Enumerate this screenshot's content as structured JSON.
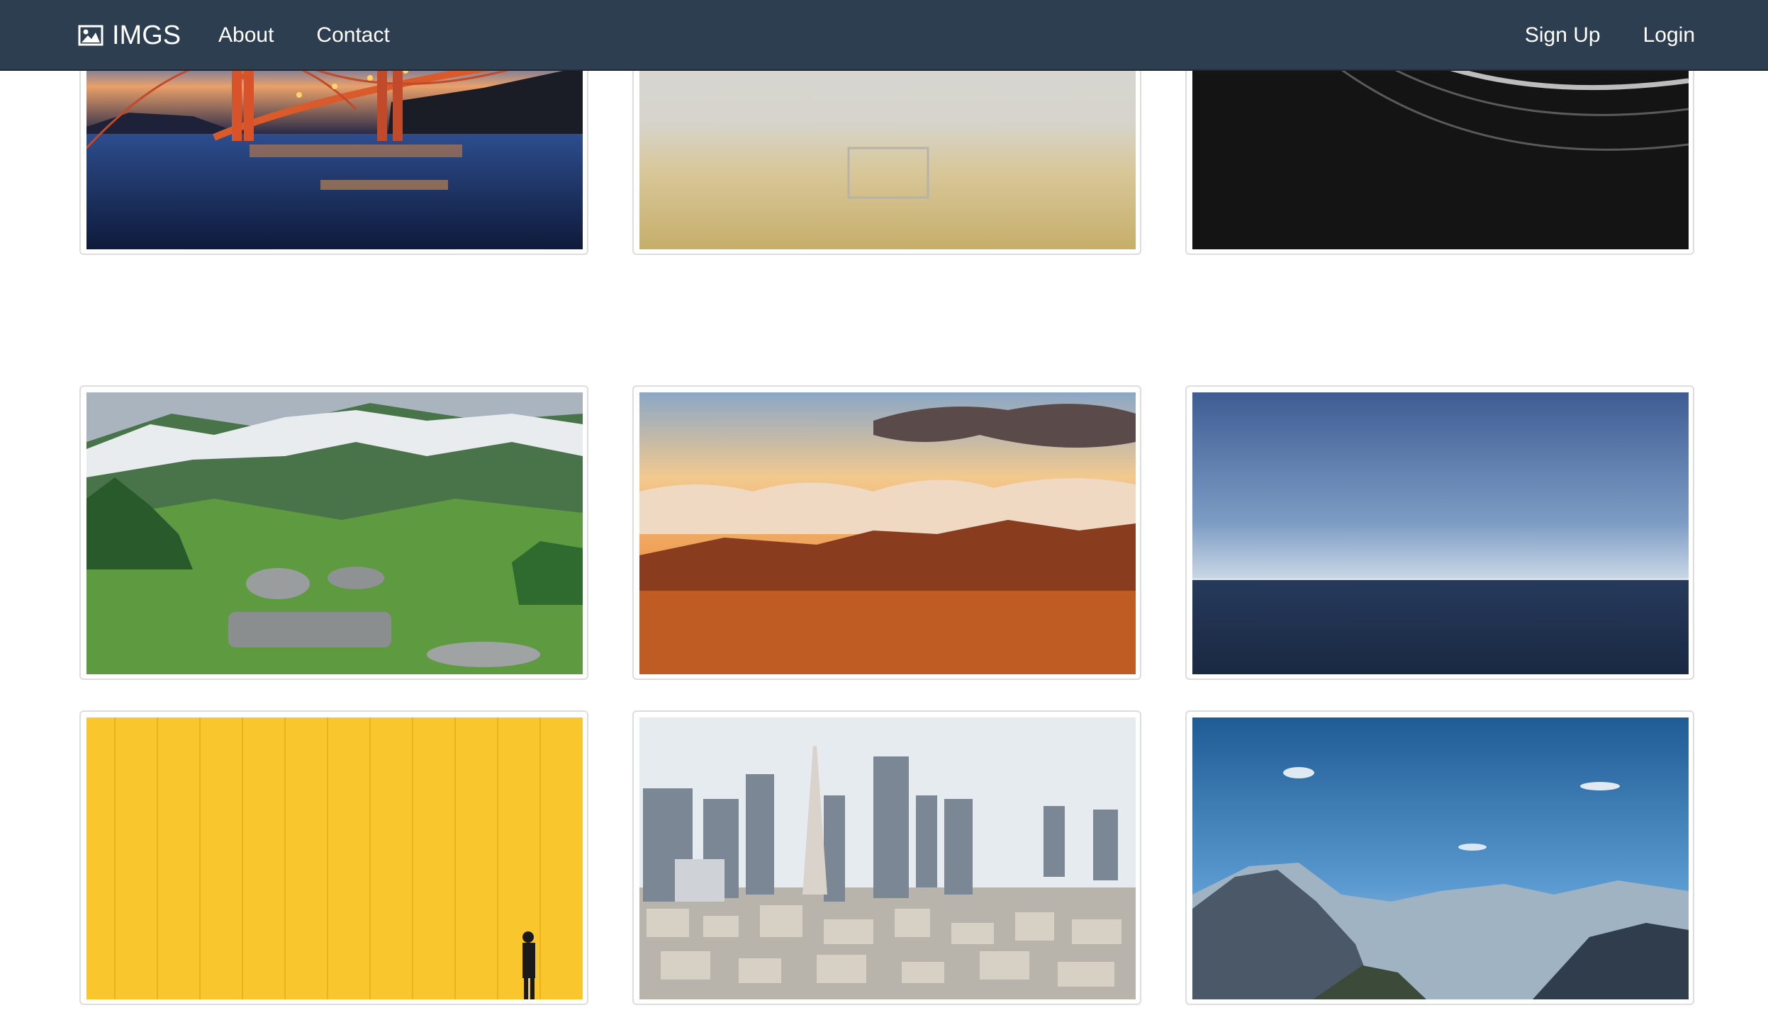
{
  "navbar": {
    "brand": "IMGS",
    "brand_icon": "image-icon",
    "links_left": [
      {
        "label": "About"
      },
      {
        "label": "Contact"
      }
    ],
    "links_right": [
      {
        "label": "Sign Up"
      },
      {
        "label": "Login"
      }
    ],
    "background": "#2c3e50"
  },
  "gallery": {
    "thumbnails": [
      {
        "subject": "golden-gate-bridge-photo"
      },
      {
        "subject": "foggy-soccer-field-photo"
      },
      {
        "subject": "abstract-architecture-photo"
      },
      {
        "subject": "green-mountain-valley-photo"
      },
      {
        "subject": "sunset-clouds-mountains-photo"
      },
      {
        "subject": "calm-sea-horizon-photo"
      },
      {
        "subject": "yellow-wall-person-photo"
      },
      {
        "subject": "city-skyline-photo"
      },
      {
        "subject": "blue-sky-mountains-photo"
      }
    ]
  }
}
